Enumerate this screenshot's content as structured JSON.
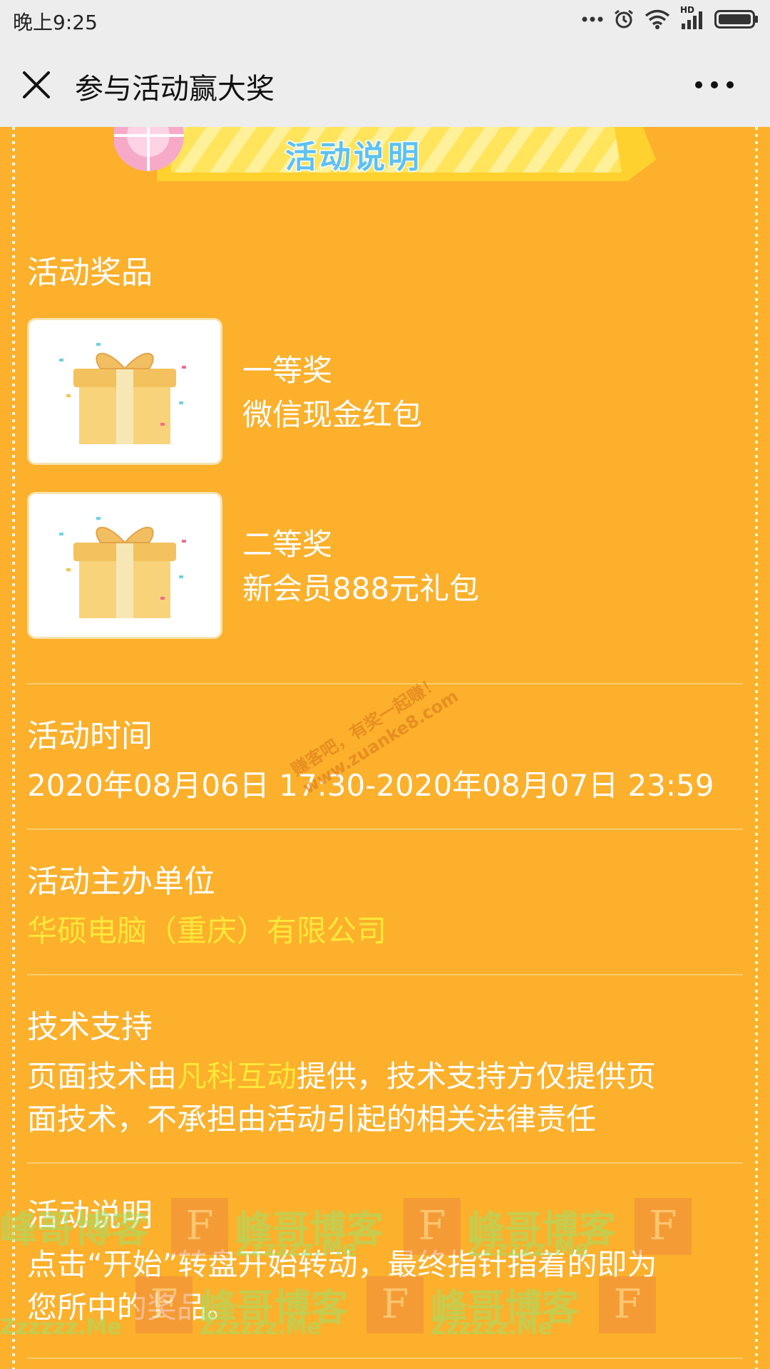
{
  "status_bar": {
    "time": "晚上9:25",
    "network_label": "HD"
  },
  "nav": {
    "title": "参与活动赢大奖"
  },
  "banner": {
    "title": "活动说明"
  },
  "prizes": {
    "heading": "活动奖品",
    "items": [
      {
        "rank": "一等奖",
        "name": "微信现金红包"
      },
      {
        "rank": "二等奖",
        "name": "新会员888元礼包"
      }
    ]
  },
  "time_section": {
    "heading": "活动时间",
    "value": "2020年08月06日 17:30-2020年08月07日 23:59"
  },
  "organizer_section": {
    "heading": "活动主办单位",
    "value": "华硕电脑（重庆）有限公司"
  },
  "tech_section": {
    "heading": "技术支持",
    "prefix": "页面技术由",
    "link": "凡科互动",
    "suffix_line1": "提供，技术支持方仅提供页",
    "line2": "面技术，不承担由活动引起的相关法律责任"
  },
  "desc_section": {
    "heading": "活动说明",
    "line1": "点击“开始”转盘开始转动，最终指针指着的即为",
    "line2": "您所中的奖品。"
  },
  "watermarks": {
    "diag_line1": "赚客吧，有奖一起赚！",
    "diag_line2": "www.zuanke8.com",
    "blog_name": "峰哥博客",
    "blog_letter": "F",
    "blog_url": "Zzzzzz.Me"
  },
  "colors": {
    "background": "#FCB02B",
    "highlight": "#FFE83A",
    "bar": "#EDEDED"
  }
}
